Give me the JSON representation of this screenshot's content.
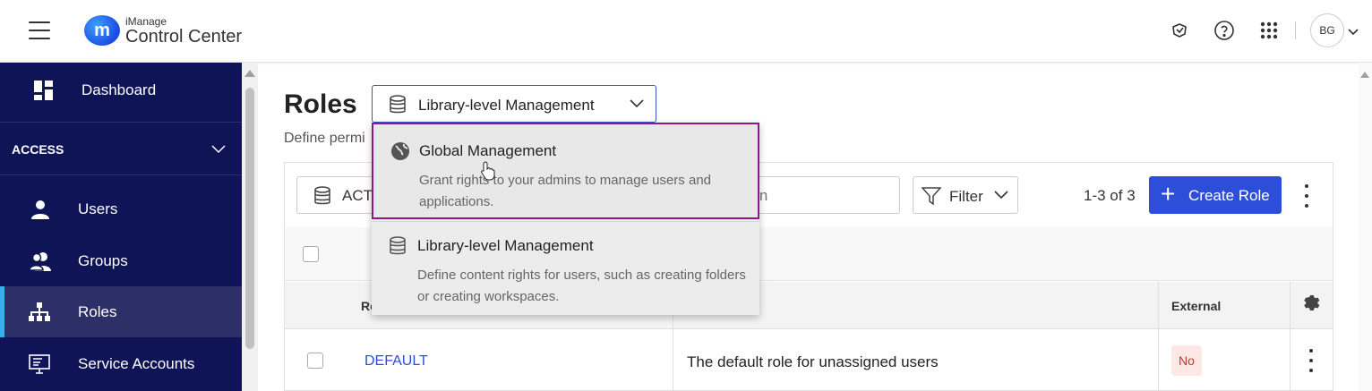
{
  "header": {
    "logo_small": "iManage",
    "logo_title": "Control Center",
    "logo_glyph": "m",
    "avatar_initials": "BG"
  },
  "sidebar": {
    "dashboard": "Dashboard",
    "section": "ACCESS",
    "items": [
      {
        "label": "Users",
        "icon": "user-icon"
      },
      {
        "label": "Groups",
        "icon": "groups-icon"
      },
      {
        "label": "Roles",
        "icon": "hierarchy-icon",
        "active": true
      },
      {
        "label": "Service Accounts",
        "icon": "monitor-icon"
      }
    ]
  },
  "main": {
    "title": "Roles",
    "description": "Define permi",
    "scope_select": "Library-level Management",
    "status_filter": "ACT",
    "search_placeholder": "ription",
    "filter_label": "Filter",
    "count": "1-3 of 3",
    "create_label": "Create Role"
  },
  "table": {
    "headers": {
      "role": "Ro",
      "external": "External"
    },
    "rows": [
      {
        "name": "DEFAULT",
        "description": "The default role for unassigned users",
        "external": "No"
      }
    ]
  },
  "dropdown": {
    "options": [
      {
        "title": "Global Management",
        "description": "Grant rights to your admins to manage users and applications.",
        "icon": "globe-icon",
        "highlighted": true
      },
      {
        "title": "Library-level Management",
        "description": "Define content rights for users, such as creating folders or creating workspaces.",
        "icon": "database-icon"
      }
    ]
  },
  "colors": {
    "sidebar_bg": "#0e1456",
    "accent": "#2c4ed8",
    "highlight_border": "#8a1a8a"
  }
}
